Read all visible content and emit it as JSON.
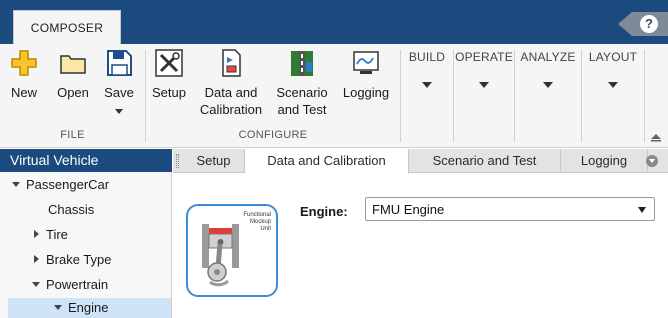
{
  "app": {
    "tab_label": "COMPOSER",
    "help_label": "?"
  },
  "ribbon": {
    "file": {
      "group_label": "FILE",
      "new_label": "New",
      "open_label": "Open",
      "save_label": "Save"
    },
    "configure": {
      "group_label": "CONFIGURE",
      "setup_label": "Setup",
      "data_calibration_label": [
        "Data and",
        "Calibration"
      ],
      "scenario_test_label": [
        "Scenario",
        "and Test"
      ],
      "logging_label": "Logging"
    },
    "dropdowns": [
      "BUILD",
      "OPERATE",
      "ANALYZE",
      "LAYOUT"
    ]
  },
  "left_panel": {
    "title": "Virtual Vehicle",
    "tree": [
      {
        "label": "PassengerCar",
        "state": "expanded"
      },
      {
        "label": "Chassis",
        "state": "leaf"
      },
      {
        "label": "Tire",
        "state": "collapsed"
      },
      {
        "label": "Brake Type",
        "state": "collapsed"
      },
      {
        "label": "Powertrain",
        "state": "expanded"
      },
      {
        "label": "Engine",
        "state": "expanded-selected"
      }
    ]
  },
  "content_tabs": [
    {
      "label": "Setup",
      "active": false
    },
    {
      "label": "Data and Calibration",
      "active": true
    },
    {
      "label": "Scenario and Test",
      "active": false
    },
    {
      "label": "Logging",
      "active": false
    }
  ],
  "engine_config": {
    "label": "Engine:",
    "selected": "FMU Engine",
    "badge_text": [
      "Functional",
      "Mockup",
      "Unit"
    ]
  },
  "colors": {
    "title_bar": "#1b4a7f",
    "ribbon_bg": "#f5f5f5",
    "selection": "#cfe3f7",
    "accent_blue": "#3a8fd6"
  }
}
